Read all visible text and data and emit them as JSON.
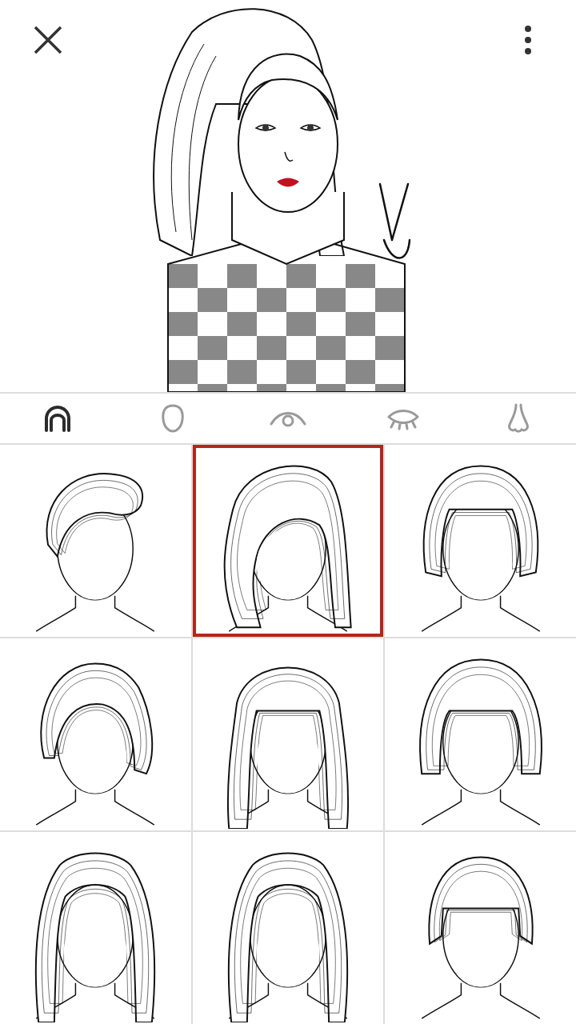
{
  "tabs": [
    {
      "kind": "hair",
      "selected": true
    },
    {
      "kind": "face",
      "selected": false
    },
    {
      "kind": "eye",
      "selected": false
    },
    {
      "kind": "lashes",
      "selected": false
    },
    {
      "kind": "nose",
      "selected": false
    }
  ],
  "styles": [
    {
      "kind": "undercut",
      "selected": false
    },
    {
      "kind": "long-side",
      "selected": true
    },
    {
      "kind": "bob",
      "selected": false
    },
    {
      "kind": "curly",
      "selected": false
    },
    {
      "kind": "long-bangs",
      "selected": false
    },
    {
      "kind": "short-bob",
      "selected": false
    },
    {
      "kind": "long-part",
      "selected": false
    },
    {
      "kind": "long-part",
      "selected": false
    },
    {
      "kind": "blunt",
      "selected": false
    }
  ]
}
